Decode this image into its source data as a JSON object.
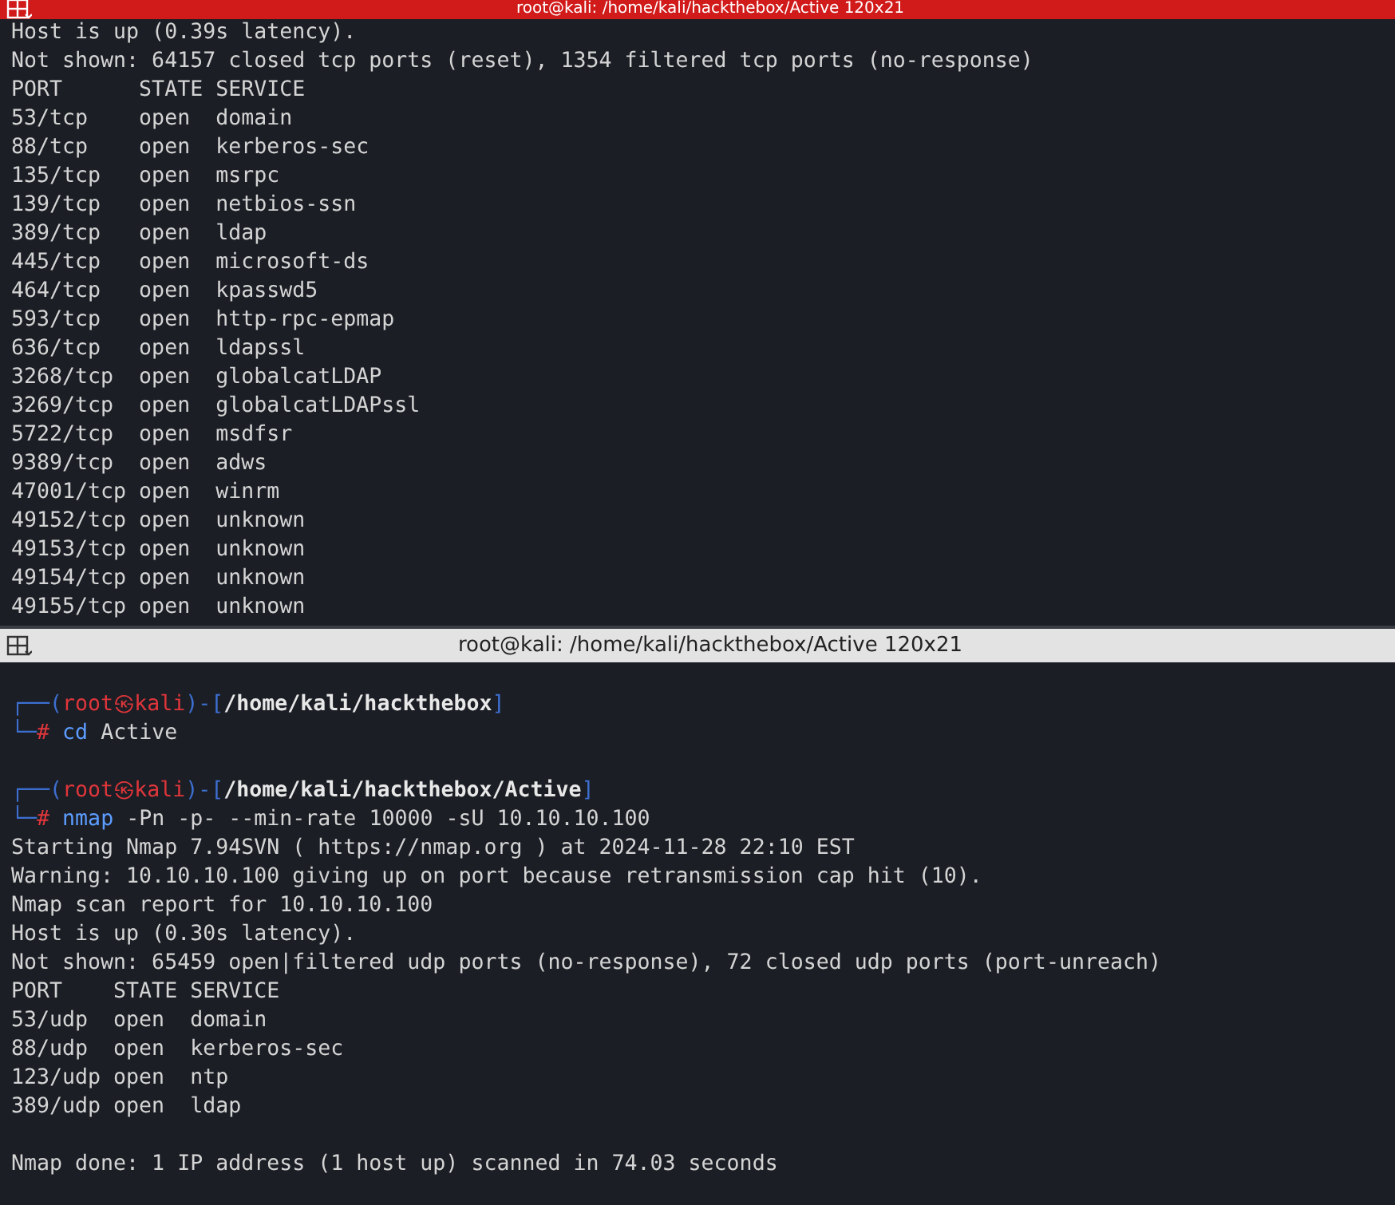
{
  "top_pane": {
    "title": "root@kali: /home/kali/hackthebox/Active 120x21",
    "focused": true,
    "lines": [
      {
        "kind": "output",
        "text": "Host is up (0.39s latency)."
      },
      {
        "kind": "output",
        "text": "Not shown: 64157 closed tcp ports (reset), 1354 filtered tcp ports (no-response)"
      },
      {
        "kind": "output",
        "text": "PORT      STATE SERVICE"
      },
      {
        "kind": "output",
        "text": "53/tcp    open  domain"
      },
      {
        "kind": "output",
        "text": "88/tcp    open  kerberos-sec"
      },
      {
        "kind": "output",
        "text": "135/tcp   open  msrpc"
      },
      {
        "kind": "output",
        "text": "139/tcp   open  netbios-ssn"
      },
      {
        "kind": "output",
        "text": "389/tcp   open  ldap"
      },
      {
        "kind": "output",
        "text": "445/tcp   open  microsoft-ds"
      },
      {
        "kind": "output",
        "text": "464/tcp   open  kpasswd5"
      },
      {
        "kind": "output",
        "text": "593/tcp   open  http-rpc-epmap"
      },
      {
        "kind": "output",
        "text": "636/tcp   open  ldapssl"
      },
      {
        "kind": "output",
        "text": "3268/tcp  open  globalcatLDAP"
      },
      {
        "kind": "output",
        "text": "3269/tcp  open  globalcatLDAPssl"
      },
      {
        "kind": "output",
        "text": "5722/tcp  open  msdfsr"
      },
      {
        "kind": "output",
        "text": "9389/tcp  open  adws"
      },
      {
        "kind": "output",
        "text": "47001/tcp open  winrm"
      },
      {
        "kind": "output",
        "text": "49152/tcp open  unknown"
      },
      {
        "kind": "output",
        "text": "49153/tcp open  unknown"
      },
      {
        "kind": "output",
        "text": "49154/tcp open  unknown"
      },
      {
        "kind": "output",
        "text": "49155/tcp open  unknown"
      }
    ]
  },
  "bottom_pane": {
    "title": "root@kali: /home/kali/hackthebox/Active 120x21",
    "focused": false,
    "lines": [
      {
        "kind": "blank"
      },
      {
        "kind": "prompt",
        "open": "┌──(",
        "user": "root",
        "at": "㉿",
        "host": "kali",
        "mid": ")-[",
        "path": "/home/kali/hackthebox",
        "close": "]"
      },
      {
        "kind": "command",
        "mark": "└─",
        "sigil": "#",
        "program": "cd",
        "args": "Active"
      },
      {
        "kind": "blank"
      },
      {
        "kind": "prompt",
        "open": "┌──(",
        "user": "root",
        "at": "㉿",
        "host": "kali",
        "mid": ")-[",
        "path": "/home/kali/hackthebox/Active",
        "close": "]"
      },
      {
        "kind": "command",
        "mark": "└─",
        "sigil": "#",
        "program": "nmap",
        "args": "-Pn -p- --min-rate 10000 -sU 10.10.10.100"
      },
      {
        "kind": "output",
        "text": "Starting Nmap 7.94SVN ( https://nmap.org ) at 2024-11-28 22:10 EST"
      },
      {
        "kind": "output",
        "text": "Warning: 10.10.10.100 giving up on port because retransmission cap hit (10)."
      },
      {
        "kind": "output",
        "text": "Nmap scan report for 10.10.10.100"
      },
      {
        "kind": "output",
        "text": "Host is up (0.30s latency)."
      },
      {
        "kind": "output",
        "text": "Not shown: 65459 open|filtered udp ports (no-response), 72 closed udp ports (port-unreach)"
      },
      {
        "kind": "output",
        "text": "PORT    STATE SERVICE"
      },
      {
        "kind": "output",
        "text": "53/udp  open  domain"
      },
      {
        "kind": "output",
        "text": "88/udp  open  kerberos-sec"
      },
      {
        "kind": "output",
        "text": "123/udp open  ntp"
      },
      {
        "kind": "output",
        "text": "389/udp open  ldap"
      },
      {
        "kind": "blank"
      },
      {
        "kind": "output",
        "text": "Nmap done: 1 IP address (1 host up) scanned in 74.03 seconds"
      }
    ]
  }
}
